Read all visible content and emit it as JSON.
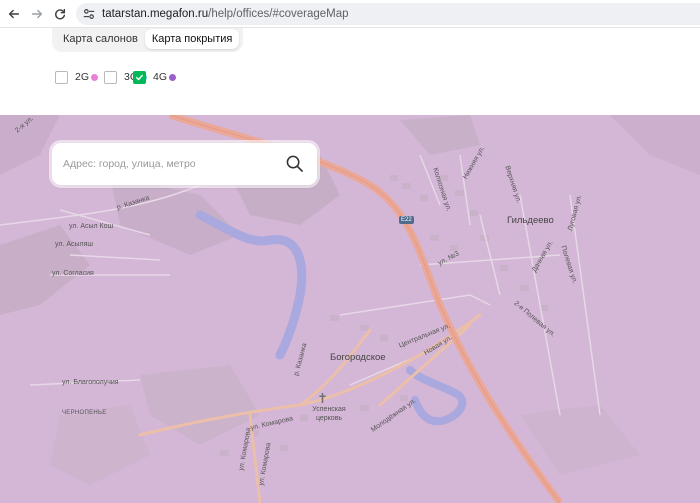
{
  "browser": {
    "url_host": "tatarstan.megafon.ru",
    "url_path": "/help/offices/#coverageMap"
  },
  "tabs": [
    {
      "label": "Карта салонов",
      "active": false
    },
    {
      "label": "Карта покрытия",
      "active": true
    }
  ],
  "filters": [
    {
      "label": "2G",
      "checked": false,
      "color": "#e87fd8"
    },
    {
      "label": "3G",
      "checked": false,
      "color": "#5fcfea"
    },
    {
      "label": "4G",
      "checked": true,
      "color": "#9a5fc9"
    }
  ],
  "search": {
    "placeholder": "Адрес: город, улица, метро"
  },
  "map": {
    "coverage_color": "#d4b6d6",
    "labels": {
      "bogorodskoe": "Богородское",
      "gildeevo": "Гильдеево",
      "uspenskaya": "Успенская церковь",
      "chernopene": "ЧЕРНОПЕНЬЕ",
      "ul_asyl_kosh": "ул. Асыл Кош",
      "ul_asylyash": "ул. Асыляш",
      "ul_soglasiya": "ул. Согласия",
      "ul_blagopoluchiya": "ул. Благополучия",
      "ul_komarova": "ул. Комарова",
      "ul_komarova_2": "ул. Комарова",
      "ul_komarova_3": "ул. Комарова",
      "tsentralnaya": "Центральная ул.",
      "novaya": "Новая ул.",
      "molodezhnaya": "Молодёжная ул.",
      "ul_n3": "ул. №3",
      "kolkhoznaya": "Колхозная ул.",
      "nizhnyaya": "Нижняя ул.",
      "vernaya": "Верхняя ул.",
      "lugovaya": "Луговая ул.",
      "dachnaya": "Дачная ул.",
      "polevaya": "Полевая ул.",
      "polevaya_2": "2-я Полевая ул.",
      "kazanka": "р. Казанка",
      "kazanka_2": "р. Казанка",
      "second_ul": "2-я ул.",
      "road_e22": "E22"
    }
  }
}
